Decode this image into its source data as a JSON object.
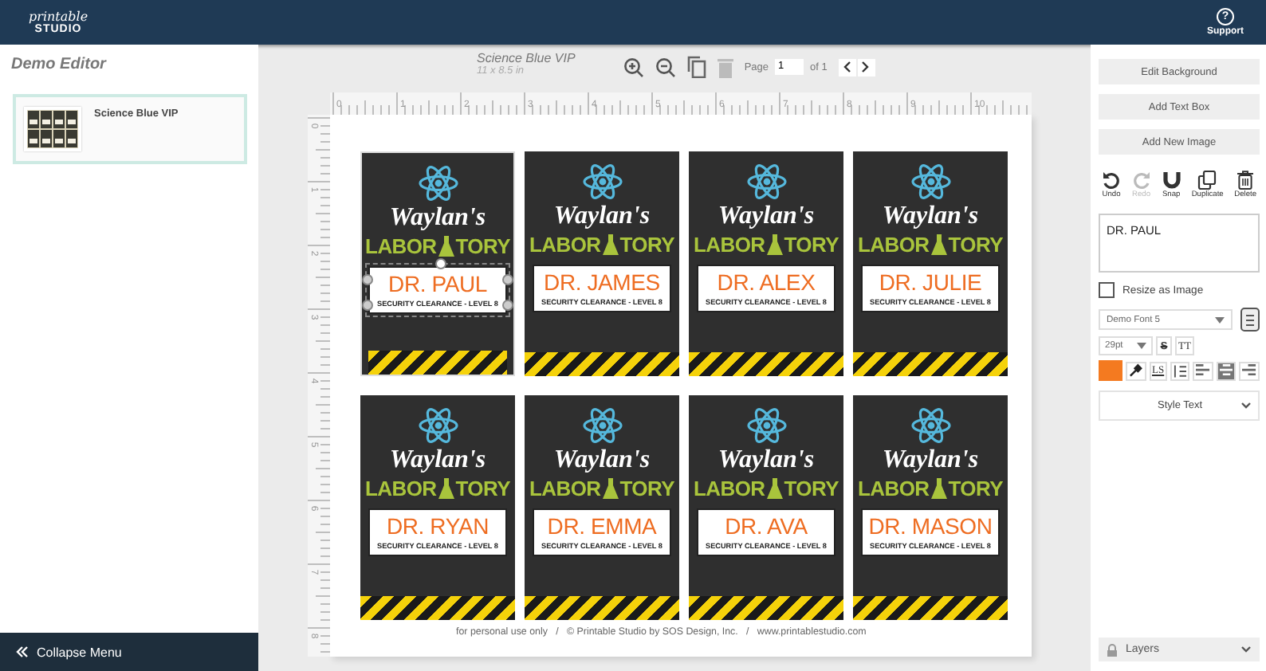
{
  "header": {
    "logo_script": "printable",
    "logo_word": "STUDIO",
    "help_glyph": "?",
    "support": "Support"
  },
  "sidebar": {
    "title": "Demo Editor",
    "templates": [
      {
        "name": "Science Blue VIP",
        "selected": true
      }
    ],
    "collapse": "Collapse Menu"
  },
  "document": {
    "title": "Science Blue VIP",
    "size": "11 x 8.5 in",
    "page_label": "Page",
    "page": "1",
    "page_of": "of 1",
    "ruler_h": [
      "0",
      "1",
      "2",
      "3",
      "4",
      "5",
      "6",
      "7",
      "8",
      "9",
      "10"
    ],
    "ruler_v": [
      "0",
      "1",
      "2",
      "3",
      "4",
      "5",
      "6",
      "7",
      "8"
    ],
    "footer": "for personal use only   /   © Printable Studio by SOS Design, Inc.   /   www.printablestudio.com"
  },
  "badges": [
    {
      "script": "Waylan's",
      "title_left": "LABOR",
      "title_right": "TORY",
      "name": "DR. PAUL",
      "clearance": "SECURITY CLEARANCE - LEVEL 8",
      "selected": true
    },
    {
      "script": "Waylan's",
      "title_left": "LABOR",
      "title_right": "TORY",
      "name": "DR. JAMES",
      "clearance": "SECURITY CLEARANCE - LEVEL 8",
      "selected": false
    },
    {
      "script": "Waylan's",
      "title_left": "LABOR",
      "title_right": "TORY",
      "name": "DR. ALEX",
      "clearance": "SECURITY CLEARANCE - LEVEL 8",
      "selected": false
    },
    {
      "script": "Waylan's",
      "title_left": "LABOR",
      "title_right": "TORY",
      "name": "DR. JULIE",
      "clearance": "SECURITY CLEARANCE - LEVEL 8",
      "selected": false
    },
    {
      "script": "Waylan's",
      "title_left": "LABOR",
      "title_right": "TORY",
      "name": "DR. RYAN",
      "clearance": "SECURITY CLEARANCE - LEVEL 8",
      "selected": false
    },
    {
      "script": "Waylan's",
      "title_left": "LABOR",
      "title_right": "TORY",
      "name": "DR. EMMA",
      "clearance": "SECURITY CLEARANCE - LEVEL 8",
      "selected": false
    },
    {
      "script": "Waylan's",
      "title_left": "LABOR",
      "title_right": "TORY",
      "name": "DR. AVA",
      "clearance": "SECURITY CLEARANCE - LEVEL 8",
      "selected": false
    },
    {
      "script": "Waylan's",
      "title_left": "LABOR",
      "title_right": "TORY",
      "name": "DR. MASON",
      "clearance": "SECURITY CLEARANCE - LEVEL 8",
      "selected": false
    }
  ],
  "panel": {
    "buttons": [
      "Edit Background",
      "Add Text Box",
      "Add New Image"
    ],
    "tools": [
      {
        "kind": "undo",
        "label": "Undo",
        "disabled": false
      },
      {
        "kind": "redo",
        "label": "Redo",
        "disabled": true
      },
      {
        "kind": "snap",
        "label": "Snap",
        "disabled": false
      },
      {
        "kind": "duplicate",
        "label": "Duplicate",
        "disabled": false
      },
      {
        "kind": "delete",
        "label": "Delete",
        "disabled": false
      }
    ],
    "text_value": "DR. PAUL",
    "resize_as_image": {
      "label": "Resize as Image",
      "checked": false
    },
    "font": "Demo Font 5",
    "size": "29pt",
    "strike": "S",
    "case": "TT",
    "spacing": "LS",
    "color": "#f47a20",
    "align": [
      {
        "kind": "left",
        "selected": false
      },
      {
        "kind": "center",
        "selected": true
      },
      {
        "kind": "right",
        "selected": false
      }
    ],
    "style_text": "Style Text",
    "layers": "Layers"
  }
}
